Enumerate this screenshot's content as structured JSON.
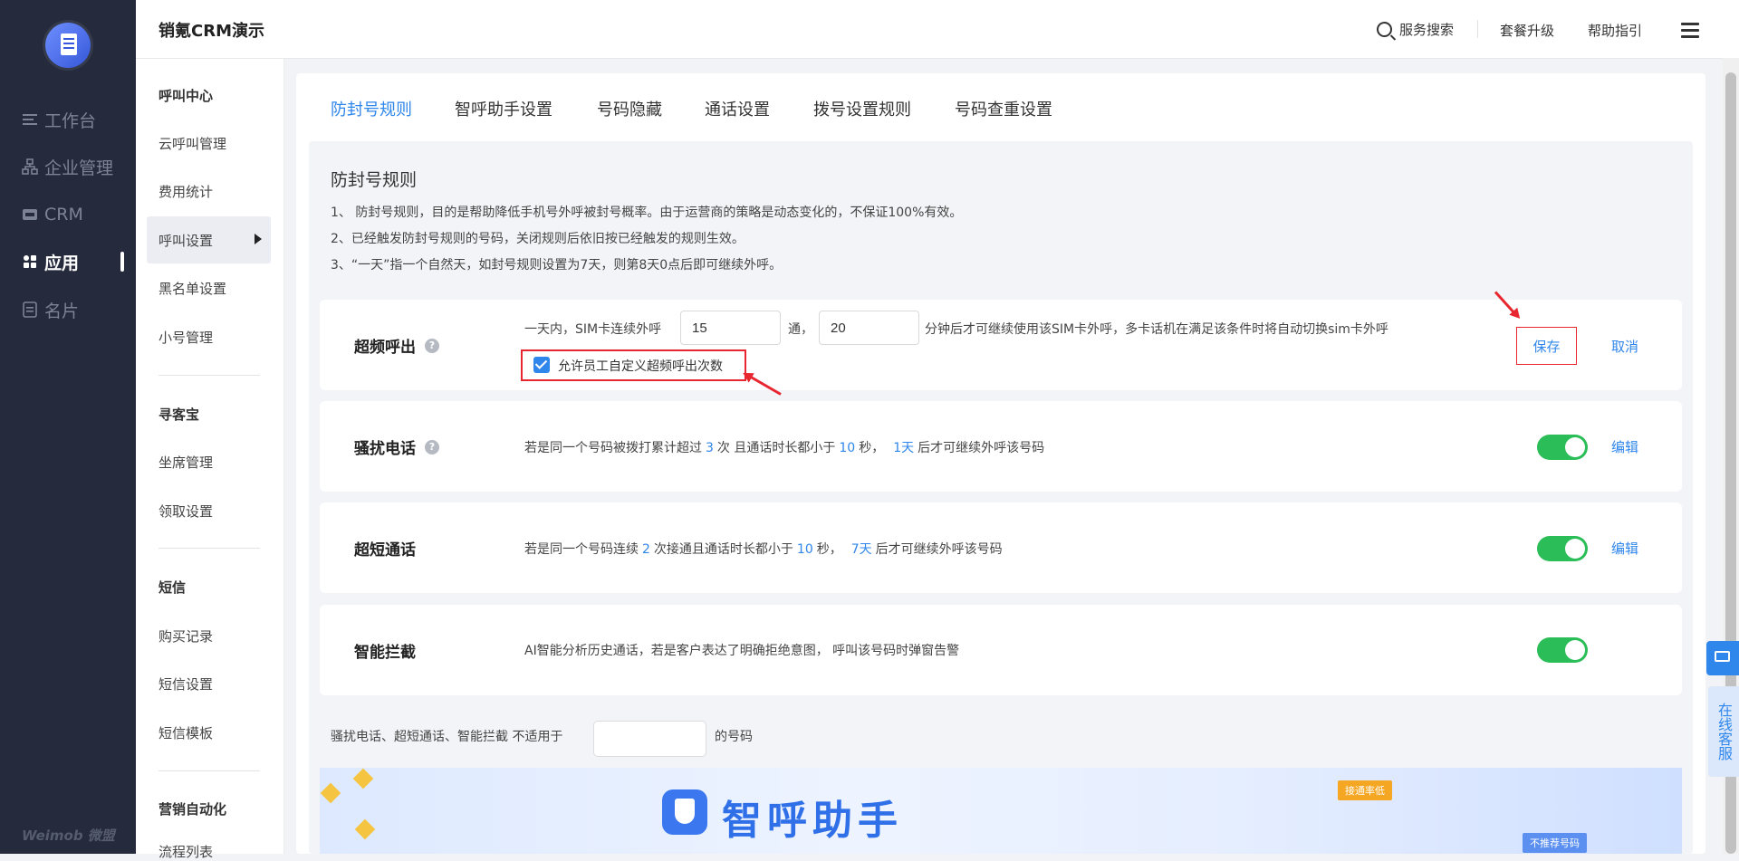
{
  "nav": {
    "items": [
      {
        "label": "工作台",
        "icon": "list-icon"
      },
      {
        "label": "企业管理",
        "icon": "org-icon"
      },
      {
        "label": "CRM",
        "icon": "crm-icon"
      },
      {
        "label": "应用",
        "icon": "apps-icon"
      },
      {
        "label": "名片",
        "icon": "card-icon"
      }
    ],
    "active_index": 3,
    "footer": "Weimob 微盟"
  },
  "header": {
    "brand": "销氪CRM演示",
    "search_label": "服务搜索",
    "upgrade_label": "套餐升级",
    "help_label": "帮助指引"
  },
  "subnav": {
    "groups": [
      {
        "title": "呼叫中心",
        "items": [
          "云呼叫管理",
          "费用统计",
          "呼叫设置",
          "黑名单设置",
          "小号管理"
        ]
      },
      {
        "title": "寻客宝",
        "items": [
          "坐席管理",
          "领取设置"
        ]
      },
      {
        "title": "短信",
        "items": [
          "购买记录",
          "短信设置",
          "短信模板"
        ]
      },
      {
        "title": "营销自动化",
        "items": [
          "流程列表"
        ]
      }
    ],
    "active_item": "呼叫设置"
  },
  "tabs": [
    "防封号规则",
    "智呼助手设置",
    "号码隐藏",
    "通话设置",
    "拨号设置规则",
    "号码查重设置"
  ],
  "active_tab": 0,
  "section": {
    "title": "防封号规则",
    "rules": [
      "1、 防封号规则，目的是帮助降低手机号外呼被封号概率。由于运营商的策略是动态变化的，不保证100%有效。",
      "2、已经触发防封号规则的号码，关闭规则后依旧按已经触发的规则生效。",
      "3、“一天”指一个自然天，如封号规则设置为7天，则第8天0点后即可继续外呼。"
    ]
  },
  "cards": {
    "overcall": {
      "title": "超频呼出",
      "help": "?",
      "prefix": "一天内，SIM卡连续外呼",
      "count_value": "15",
      "unit1": "通，",
      "minutes_value": "20",
      "suffix": "分钟后才可继续使用该SIM卡外呼，多卡话机在满足该条件时将自动切换sim卡外呼",
      "checkbox_label": "允许员工自定义超频呼出次数",
      "checkbox_checked": true,
      "save_label": "保存",
      "cancel_label": "取消"
    },
    "harass": {
      "title": "骚扰电话",
      "help": "?",
      "t1": "若是同一个号码被拨打累计超过",
      "count": "3",
      "t2": "次 且通话时长都小于",
      "seconds": "10",
      "t3": "秒，",
      "days": "1天",
      "t4": "后才可继续外呼该号码",
      "enabled": true,
      "edit_label": "编辑"
    },
    "short": {
      "title": "超短通话",
      "t1": "若是同一个号码连续",
      "count": "2",
      "t2": "次接通且通话时长都小于",
      "seconds": "10",
      "t3": "秒，",
      "days": "7天",
      "t4": "后才可继续外呼该号码",
      "enabled": true,
      "edit_label": "编辑"
    },
    "intercept": {
      "title": "智能拦截",
      "desc": "AI智能分析历史通话，若是客户表达了明确拒绝意图， 呼叫该号码时弹窗告警",
      "enabled": true
    }
  },
  "exclude": {
    "prefix": "骚扰电话、超短通话、智能拦截 不适用于",
    "value": "",
    "suffix": "的号码"
  },
  "banner": {
    "title": "智呼助手",
    "tag1": "接通率低",
    "tag2": "不推荐号码"
  },
  "float": {
    "service_label": "在线客服"
  },
  "colors": {
    "accent": "#2f86eb",
    "nav_bg": "#252b3d",
    "toggle_on": "#2bbd58",
    "highlight_red": "#e8262f"
  }
}
